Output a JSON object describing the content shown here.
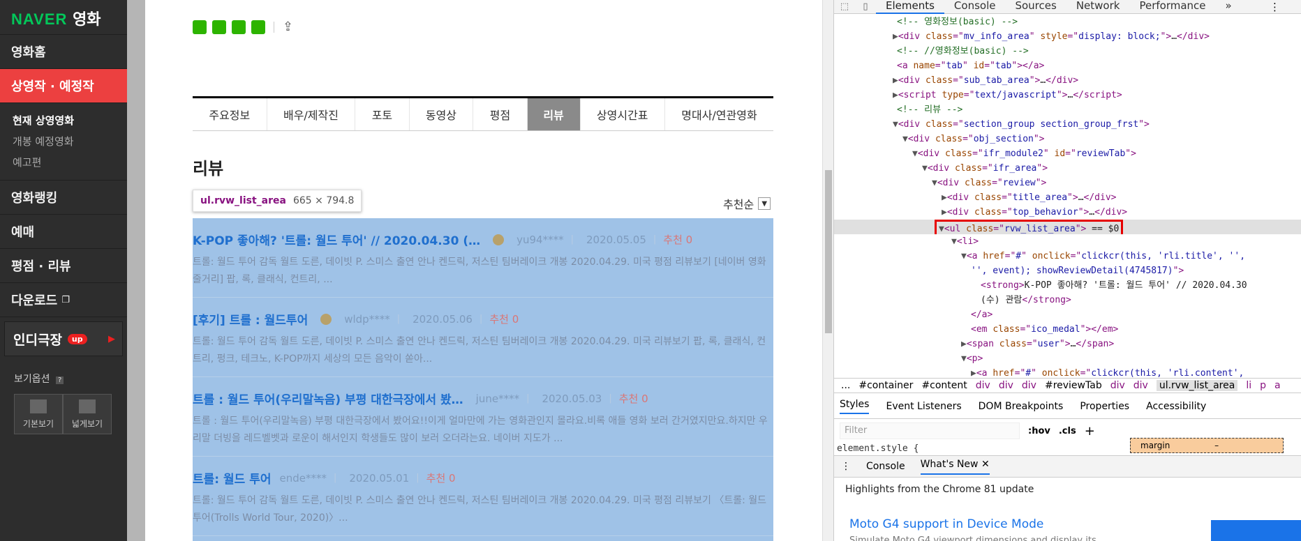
{
  "sidebar": {
    "logo_brand": "NAVER",
    "logo_title": "영화",
    "items": [
      {
        "label": "영화홈"
      },
      {
        "label": "상영작 · 예정작"
      },
      {
        "label": "영화랭킹"
      },
      {
        "label": "예매"
      },
      {
        "label": "평점 · 리뷰"
      },
      {
        "label": "다운로드"
      }
    ],
    "submenu": [
      "현재 상영영화",
      "개봉 예정영화",
      "예고편"
    ],
    "indie": {
      "label": "인디극장",
      "badge": "up"
    },
    "view_options": {
      "title": "보기옵션",
      "basic": "기본보기",
      "wide": "넓게보기"
    }
  },
  "tabs": [
    "주요정보",
    "배우/제작진",
    "포토",
    "동영상",
    "평점",
    "리뷰",
    "상영시간표",
    "명대사/연관영화"
  ],
  "active_tab": "리뷰",
  "section_title": "리뷰",
  "tooltip": {
    "selector": "ul.rvw_list_area",
    "size": "665 × 794.8"
  },
  "sort_label": "추천순",
  "reviews": [
    {
      "title": "K-POP 좋아해? '트롤: 월드 투어' // 2020.04.30 (…",
      "user": "yu94****",
      "date": "2020.05.05",
      "rec": "추천 0",
      "body": "트롤: 월드 투어 감독 월트 도른, 데이빗 P. 스미스 출연 안나 켄드릭, 저스틴 팀버레이크 개봉 2020.04.29. 미국 평점 리뷰보기 [네이버 영화 줄거리] 팝, 록, 클래식, 컨트리, ..."
    },
    {
      "title": "[후기] 트롤 : 월드투어",
      "user": "wldp****",
      "date": "2020.05.06",
      "rec": "추천 0",
      "body": "트롤: 월드 투어 감독 월트 도른, 데이빗 P. 스미스 출연 안나 켄드릭, 저스틴 팀버레이크 개봉 2020.04.29. 미국 리뷰보기 팝, 록, 클래식, 컨트리, 펑크, 테크노, K-POP까지 세상의 모든 음악이 쏟아..."
    },
    {
      "title": "트롤 : 월드 투어(우리말녹음) 부평 대한극장에서 봤…",
      "user": "june****",
      "date": "2020.05.03",
      "rec": "추천 0",
      "body": "트롤 : 월드 투어(우리말녹음) 부평 대한극장에서 봤어요!!이게 얼마만에 가는 영화관인지 몰라요.비록 애들 영화 보러 간거였지만요.하지만 우리말 더빙을 레드벨벳과 로운이 해서인지 학생들도 많이 보러 오더라는요. 네이버 지도가 ..."
    },
    {
      "title": "트롤: 월드 투어",
      "user": "ende****",
      "date": "2020.05.01",
      "rec": "추천 0",
      "body": "트롤: 월드 투어 감독 월트 도른, 데이빗 P. 스미스 출연 안나 켄드릭, 저스틴 팀버레이크 개봉 2020.04.29. 미국 평점 리뷰보기 〈트롤: 월드 투어(Trolls World Tour, 2020)〉..."
    }
  ],
  "devtools": {
    "tabs": [
      "Elements",
      "Console",
      "Sources",
      "Network",
      "Performance",
      "»"
    ],
    "lines": [
      {
        "indent": 90,
        "tw": "",
        "html": "<span class='c'>&lt;!-- 영화정보(basic) --&gt;</span>"
      },
      {
        "indent": 84,
        "tw": "▶",
        "html": "&lt;div <span class='an'>class</span>=\"<span class='av'>mv_info_area</span>\" <span class='an'>style</span>=\"<span class='av'>display: block;</span>\"&gt;<span class='tx'>…</span>&lt;/div&gt;"
      },
      {
        "indent": 90,
        "tw": "",
        "html": "<span class='c'>&lt;!-- //영화정보(basic) --&gt;</span>"
      },
      {
        "indent": 90,
        "tw": "",
        "html": "&lt;a <span class='an'>name</span>=\"<span class='av'>tab</span>\" <span class='an'>id</span>=\"<span class='av'>tab</span>\"&gt;&lt;/a&gt;"
      },
      {
        "indent": 84,
        "tw": "▶",
        "html": "&lt;div <span class='an'>class</span>=\"<span class='av'>sub_tab_area</span>\"&gt;<span class='tx'>…</span>&lt;/div&gt;"
      },
      {
        "indent": 84,
        "tw": "▶",
        "html": "&lt;script <span class='an'>type</span>=\"<span class='av'>text/javascript</span>\"&gt;<span class='tx'>…</span>&lt;/script&gt;"
      },
      {
        "indent": 90,
        "tw": "",
        "html": "<span class='c'>&lt;!-- 리뷰 --&gt;</span>"
      },
      {
        "indent": 84,
        "tw": "▼",
        "html": "&lt;div <span class='an'>class</span>=\"<span class='av'>section_group section_group_frst</span>\"&gt;"
      },
      {
        "indent": 98,
        "tw": "▼",
        "html": "&lt;div <span class='an'>class</span>=\"<span class='av'>obj_section</span>\"&gt;"
      },
      {
        "indent": 112,
        "tw": "▼",
        "html": "&lt;div <span class='an'>class</span>=\"<span class='av'>ifr_module2</span>\" <span class='an'>id</span>=\"<span class='av'>reviewTab</span>\"&gt;"
      },
      {
        "indent": 126,
        "tw": "▼",
        "html": "&lt;div <span class='an'>class</span>=\"<span class='av'>ifr_area</span>\"&gt;"
      },
      {
        "indent": 140,
        "tw": "▼",
        "html": "&lt;div <span class='an'>class</span>=\"<span class='av'>review</span>\"&gt;"
      },
      {
        "indent": 154,
        "tw": "▶",
        "html": "&lt;div <span class='an'>class</span>=\"<span class='av'>title_area</span>\"&gt;<span class='tx'>…</span>&lt;/div&gt;"
      },
      {
        "indent": 154,
        "tw": "▶",
        "html": "&lt;div <span class='an'>class</span>=\"<span class='av'>top_behavior</span>\"&gt;<span class='tx'>…</span>&lt;/div&gt;"
      },
      {
        "indent": 144,
        "tw": "",
        "sel": true,
        "html": "<span class='redbox'><span class='tw'>▼</span>&lt;ul <span class='an'>class</span>=\"<span class='av'>rvw_list_area</span>\"&gt; <span class='tx'>== $0</span></span>"
      },
      {
        "indent": 168,
        "tw": "▼",
        "html": "&lt;li&gt;"
      },
      {
        "indent": 182,
        "tw": "▼",
        "html": "&lt;a <span class='an'>href</span>=\"<span class='av'>#</span>\" <span class='an'>onclick</span>=\"<span class='av'>clickcr(this, 'rli.title', '',</span>"
      },
      {
        "indent": 196,
        "tw": "",
        "html": "<span class='av'>'', event); showReviewDetail(4745817)</span>\"&gt;"
      },
      {
        "indent": 210,
        "tw": "",
        "html": "&lt;strong&gt;<span class='tx'>K-POP 좋아해? '트롤: 월드 투어' // 2020.04.30</span>"
      },
      {
        "indent": 210,
        "tw": "",
        "html": "<span class='tx'>(수) 관람</span>&lt;/strong&gt;"
      },
      {
        "indent": 196,
        "tw": "",
        "html": "&lt;/a&gt;"
      },
      {
        "indent": 196,
        "tw": "",
        "html": "&lt;em <span class='an'>class</span>=\"<span class='av'>ico_medal</span>\"&gt;&lt;/em&gt;"
      },
      {
        "indent": 182,
        "tw": "▶",
        "html": "&lt;span <span class='an'>class</span>=\"<span class='av'>user</span>\"&gt;<span class='tx'>…</span>&lt;/span&gt;"
      },
      {
        "indent": 182,
        "tw": "▼",
        "html": "&lt;p&gt;"
      },
      {
        "indent": 196,
        "tw": "▶",
        "html": "&lt;a <span class='an'>href</span>=\"<span class='av'>#</span>\" <span class='an'>onclick</span>=\"<span class='av'>clickcr(this, 'rli.content',</span>"
      }
    ],
    "breadcrumbs": [
      "...",
      "#container",
      "#content",
      "div",
      "div",
      "div",
      "#reviewTab",
      "div",
      "div",
      "ul.rvw_list_area",
      "li",
      "p",
      "a"
    ],
    "style_tabs": [
      "Styles",
      "Event Listeners",
      "DOM Breakpoints",
      "Properties",
      "Accessibility"
    ],
    "filter_placeholder": "Filter",
    "hov": ":hov",
    "cls": ".cls",
    "element_style": "element.style {",
    "margin_label": "margin",
    "margin_value": "–",
    "drawer_tabs": [
      "Console",
      "What's New"
    ],
    "highlights": "Highlights from the Chrome 81 update",
    "whatsnew_link": "Moto G4 support in Device Mode",
    "whatsnew_sub": "Simulate Moto G4 viewport dimensions and display its"
  }
}
